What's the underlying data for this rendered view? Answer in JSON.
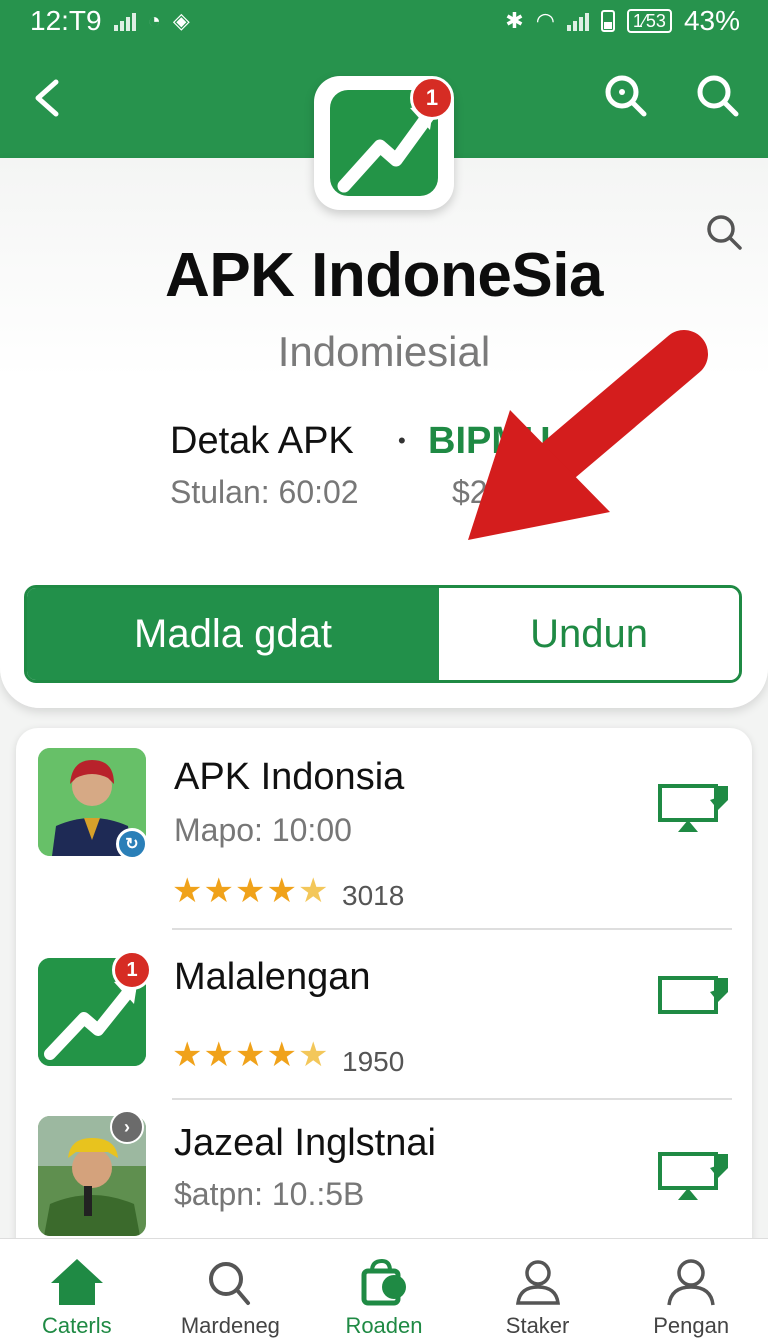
{
  "status_bar": {
    "time": "12:T9",
    "battery_box": "1⁄53",
    "battery_percent": "43%"
  },
  "app": {
    "badge": "1",
    "title": "APK IndoneSia",
    "subtitle": "Indomiesial",
    "detail_left": "Detak APK",
    "separator": "•",
    "detail_right": "BIPMU 39",
    "stat_left": "Stulan: 60:02",
    "stat_right": "$231        00"
  },
  "buttons": {
    "primary": "Madla gdat",
    "secondary": "Undun"
  },
  "list": [
    {
      "title": "APK Indonsia",
      "meta": "Mapo: 10:00",
      "count": "3018",
      "rating": 4.5
    },
    {
      "title": "Malalengan",
      "meta": "",
      "count": "1950",
      "rating": 4.5,
      "badge": "1"
    },
    {
      "title": "Jazeal Inglstnai",
      "meta": "$atpn: 10.:5B",
      "count": "",
      "rating": null
    }
  ],
  "bottom_nav": [
    {
      "label": "Caterls",
      "icon": "home-icon",
      "active": true
    },
    {
      "label": "Mardeneg",
      "icon": "search-icon",
      "active": false
    },
    {
      "label": "Roaden",
      "icon": "store-icon",
      "active": false
    },
    {
      "label": "Staker",
      "icon": "person-icon",
      "active": false
    },
    {
      "label": "Pengan",
      "icon": "profile-icon",
      "active": false
    }
  ],
  "colors": {
    "brand_green": "#27934d",
    "badge_red": "#d62c24",
    "star": "#f0a21a"
  }
}
